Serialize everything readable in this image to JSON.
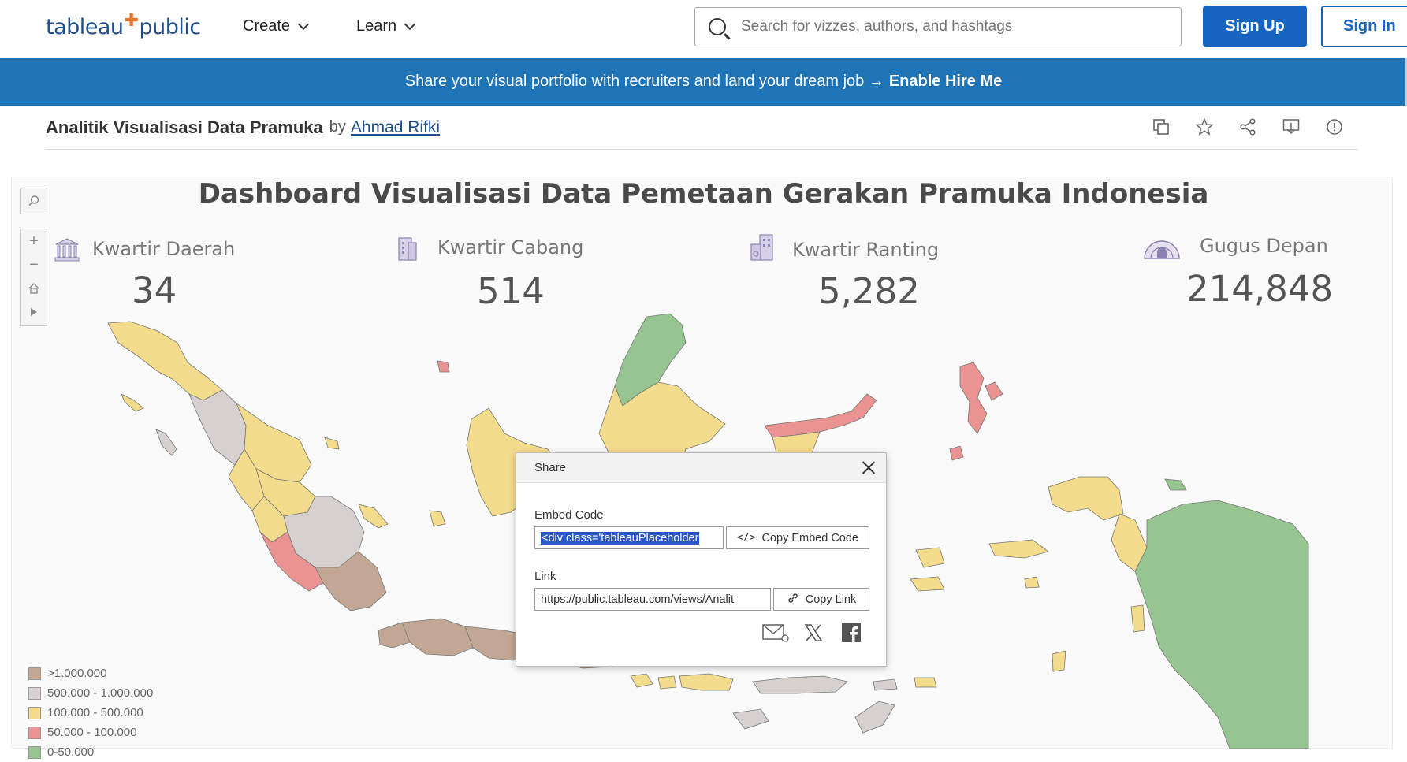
{
  "header": {
    "logo_left": "tableau",
    "logo_right": "public",
    "nav": [
      {
        "label": "Create"
      },
      {
        "label": "Learn"
      }
    ],
    "search_placeholder": "Search for vizzes, authors, and hashtags",
    "sign_up": "Sign Up",
    "sign_in": "Sign In"
  },
  "banner": {
    "text": "Share your visual portfolio with recruiters and land your dream job →",
    "cta": "Enable Hire Me"
  },
  "viz": {
    "title": "Analitik Visualisasi Data Pramuka",
    "by": "by",
    "author": "Ahmad Rifki"
  },
  "dashboard": {
    "title": "Dashboard Visualisasi Data Pemetaan Gerakan Pramuka Indonesia",
    "kpis": [
      {
        "label": "Kwartir Daerah",
        "value": "34",
        "icon": "government-building-icon"
      },
      {
        "label": "Kwartir Cabang",
        "value": "514",
        "icon": "office-building-icon"
      },
      {
        "label": "Kwartir Ranting",
        "value": "5,282",
        "icon": "buildings-icon"
      },
      {
        "label": "Gugus Depan",
        "value": "214,848",
        "icon": "dome-tent-icon"
      }
    ],
    "legend": [
      {
        "label": ">1.000.000",
        "color": "#c2a894"
      },
      {
        "label": "500.000 - 1.000.000",
        "color": "#d6d1ce"
      },
      {
        "label": "100.000 - 500.000",
        "color": "#f3dc8c"
      },
      {
        "label": "50.000 - 100.000",
        "color": "#ea9393"
      },
      {
        "label": "0-50.000",
        "color": "#97c591"
      }
    ]
  },
  "share_dialog": {
    "title": "Share",
    "embed_label": "Embed Code",
    "embed_value": "<div class='tableauPlaceholder",
    "copy_embed": "Copy Embed Code",
    "link_label": "Link",
    "link_value": "https://public.tableau.com/views/Analit",
    "copy_link": "Copy Link"
  },
  "colors": {
    "brand_blue": "#1464c0",
    "banner_blue": "#1f73b7"
  }
}
